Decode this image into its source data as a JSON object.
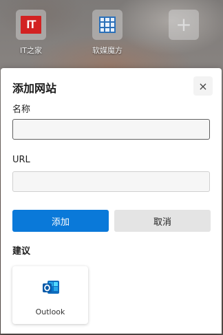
{
  "top_sites": [
    {
      "label": "IT之家",
      "logo_text": "IT",
      "logo_color": "#d22222"
    },
    {
      "label": "软媒魔方",
      "logo_color": "#2a6fb8"
    },
    {
      "label": "",
      "icon": "plus-icon"
    }
  ],
  "dialog": {
    "title": "添加网站",
    "close_glyph": "×",
    "name_label": "名称",
    "name_value": "",
    "url_label": "URL",
    "url_value": "",
    "add_label": "添加",
    "cancel_label": "取消",
    "suggestions_title": "建议",
    "suggestions": [
      {
        "label": "Outlook",
        "icon": "outlook-icon"
      }
    ]
  },
  "colors": {
    "primary": "#0a79d9",
    "secondary_button": "#e4e4e4",
    "outlook_blue": "#0f6cbd"
  }
}
